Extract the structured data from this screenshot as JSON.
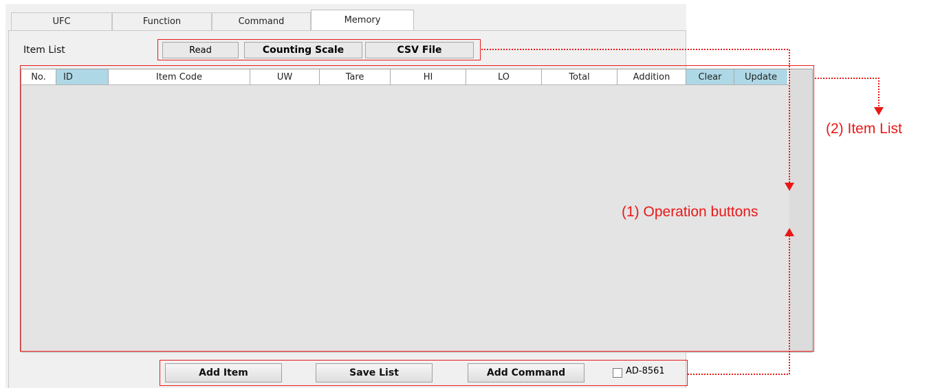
{
  "tabs": [
    {
      "label": "UFC"
    },
    {
      "label": "Function"
    },
    {
      "label": "Command"
    },
    {
      "label": "Memory"
    }
  ],
  "item_list_label": "Item List",
  "top_buttons": {
    "read": "Read",
    "counting_scale": "Counting Scale",
    "csv_file": "CSV File"
  },
  "columns": [
    "No.",
    "ID",
    "Item Code",
    "UW",
    "Tare",
    "HI",
    "LO",
    "Total",
    "Addition",
    "Clear",
    "Update"
  ],
  "bottom_buttons": {
    "add_item": "Add Item",
    "save_list": "Save List",
    "add_command": "Add Command"
  },
  "checkbox": {
    "label": "AD-8561",
    "checked": false
  },
  "annotations": {
    "item_list": "(2)  Item List",
    "operation_buttons": "(1) Operation buttons"
  },
  "colors": {
    "annotation": "#e81818",
    "highlight_column": "#aed8e6"
  }
}
